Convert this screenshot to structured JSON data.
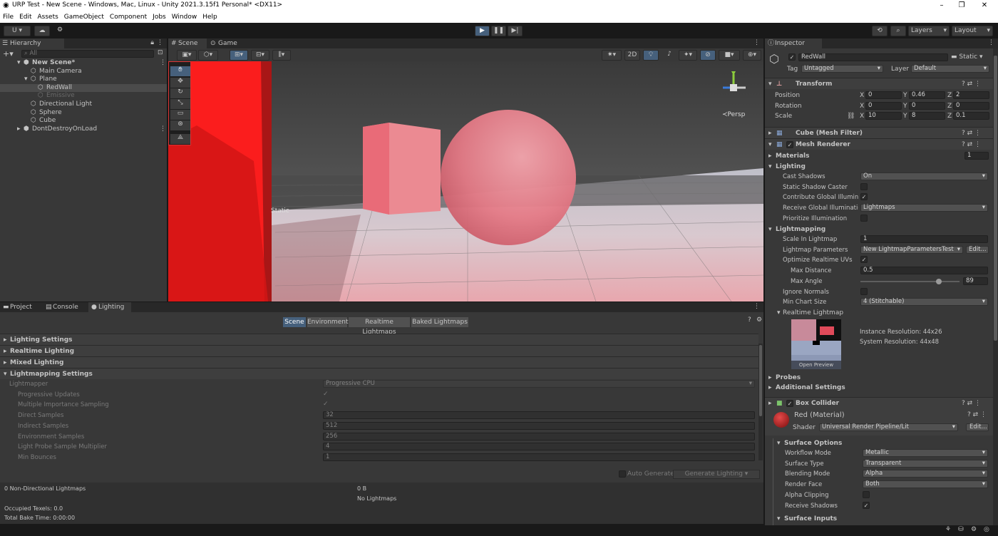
{
  "window": {
    "title": "URP Test - New Scene - Windows, Mac, Linux - Unity 2021.3.15f1 Personal* <DX11>",
    "min": "–",
    "max": "❐",
    "close": "✕"
  },
  "menu": [
    "File",
    "Edit",
    "Assets",
    "GameObject",
    "Component",
    "Jobs",
    "Window",
    "Help"
  ],
  "toolbar": {
    "account": "U ▾",
    "layers": "Layers",
    "layout": "Layout"
  },
  "hierarchy": {
    "tab": "Hierarchy",
    "search_placeholder": "All",
    "items": [
      {
        "label": "New Scene*",
        "indent": 0,
        "selected": false,
        "bold": true,
        "dim": false
      },
      {
        "label": "Main Camera",
        "indent": 1,
        "selected": false,
        "bold": false,
        "dim": false
      },
      {
        "label": "Plane",
        "indent": 1,
        "selected": false,
        "bold": false,
        "dim": false
      },
      {
        "label": "RedWall",
        "indent": 2,
        "selected": true,
        "bold": false,
        "dim": false
      },
      {
        "label": "Emissive",
        "indent": 2,
        "selected": false,
        "bold": false,
        "dim": true
      },
      {
        "label": "Directional Light",
        "indent": 1,
        "selected": false,
        "bold": false,
        "dim": false
      },
      {
        "label": "Sphere",
        "indent": 1,
        "selected": false,
        "bold": false,
        "dim": false
      },
      {
        "label": "Cube",
        "indent": 1,
        "selected": false,
        "bold": false,
        "dim": false
      },
      {
        "label": "DontDestroyOnLoad",
        "indent": 0,
        "selected": false,
        "bold": false,
        "dim": false
      }
    ]
  },
  "scene": {
    "tab_scene": "Scene",
    "tab_game": "Game",
    "mode_2d": "2D",
    "persp": "≺Persp",
    "static_label": "Static"
  },
  "bottom": {
    "tabs": [
      "Project",
      "Console",
      "Lighting"
    ],
    "subtabs": [
      "Scene",
      "Environment",
      "Realtime Lightmaps",
      "Baked Lightmaps"
    ],
    "sections": [
      "Lighting Settings",
      "Realtime Lighting",
      "Mixed Lighting",
      "Lightmapping Settings"
    ],
    "props": [
      {
        "label": "Lightmapper",
        "value": "Progressive CPU",
        "kind": "dd"
      },
      {
        "label": "Progressive Updates",
        "value": "✓",
        "kind": "chk"
      },
      {
        "label": "Multiple Importance Sampling",
        "value": "✓",
        "kind": "chk"
      },
      {
        "label": "Direct Samples",
        "value": "32",
        "kind": "fld"
      },
      {
        "label": "Indirect Samples",
        "value": "512",
        "kind": "fld"
      },
      {
        "label": "Environment Samples",
        "value": "256",
        "kind": "fld"
      },
      {
        "label": "Light Probe Sample Multiplier",
        "value": "4",
        "kind": "fld"
      },
      {
        "label": "Min Bounces",
        "value": "1",
        "kind": "fld"
      }
    ],
    "auto_generate": "Auto Generate",
    "generate": "Generate Lighting",
    "stats": {
      "lightmaps": "0 Non-Directional Lightmaps",
      "size": "0 B",
      "no_lightmaps": "No Lightmaps",
      "texels": "Occupied Texels: 0.0",
      "bake_time": "Total Bake Time: 0:00:00"
    }
  },
  "inspector": {
    "tab": "Inspector",
    "name": "RedWall",
    "static": "Static",
    "tag_label": "Tag",
    "tag": "Untagged",
    "layer_label": "Layer",
    "layer": "Default",
    "transform": {
      "title": "Transform",
      "rows": [
        {
          "label": "Position",
          "x": "0",
          "y": "0.46",
          "z": "2"
        },
        {
          "label": "Rotation",
          "x": "0",
          "y": "0",
          "z": "0"
        },
        {
          "label": "Scale",
          "x": "10",
          "y": "8",
          "z": "0.1"
        }
      ]
    },
    "mesh_filter": "Cube (Mesh Filter)",
    "mesh_renderer": "Mesh Renderer",
    "materials_label": "Materials",
    "materials_count": "1",
    "lighting_label": "Lighting",
    "lighting_rows": [
      {
        "label": "Cast Shadows",
        "value": "On",
        "kind": "dd"
      },
      {
        "label": "Static Shadow Caster",
        "value": "",
        "kind": "chk"
      },
      {
        "label": "Contribute Global Illuminati",
        "value": "✓",
        "kind": "chk"
      },
      {
        "label": "Receive Global Illuminatio",
        "value": "Lightmaps",
        "kind": "dd"
      },
      {
        "label": "Prioritize Illumination",
        "value": "",
        "kind": "chk"
      }
    ],
    "lightmapping_label": "Lightmapping",
    "lightmapping_rows": [
      {
        "label": "Scale In Lightmap",
        "value": "1"
      },
      {
        "label": "Lightmap Parameters",
        "value": "New LightmapParametersTest",
        "edit": "Edit..."
      },
      {
        "label": "Optimize Realtime UVs",
        "value": "✓"
      },
      {
        "label": "Max Distance",
        "value": "0.5"
      },
      {
        "label": "Max Angle",
        "value": "89",
        "slider": 0.79
      },
      {
        "label": "Ignore Normals",
        "value": ""
      },
      {
        "label": "Min Chart Size",
        "value": "4 (Stitchable)"
      }
    ],
    "realtime_lightmap": "Realtime Lightmap",
    "instance_res": "Instance Resolution: 44x26",
    "system_res": "System Resolution: 44x48",
    "open_preview": "Open Preview",
    "probes": "Probes",
    "additional": "Additional Settings",
    "box_collider": "Box Collider",
    "material_name": "Red (Material)",
    "shader_label": "Shader",
    "shader": "Universal Render Pipeline/Lit",
    "shader_edit": "Edit...",
    "surface_options": "Surface Options",
    "surface_rows": [
      {
        "label": "Workflow Mode",
        "value": "Metallic",
        "kind": "dd"
      },
      {
        "label": "Surface Type",
        "value": "Transparent",
        "kind": "dd"
      },
      {
        "label": "Blending Mode",
        "value": "Alpha",
        "kind": "dd"
      },
      {
        "label": "Render Face",
        "value": "Both",
        "kind": "dd"
      },
      {
        "label": "Alpha Clipping",
        "value": "",
        "kind": "chk"
      },
      {
        "label": "Receive Shadows",
        "value": "✓",
        "kind": "chk"
      }
    ],
    "surface_inputs": "Surface Inputs"
  }
}
